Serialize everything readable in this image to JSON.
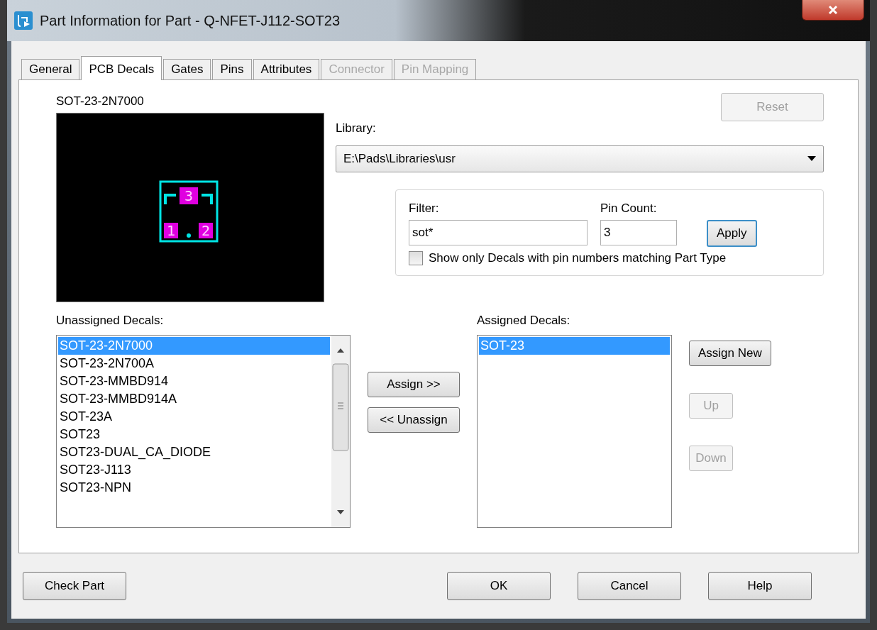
{
  "window": {
    "title": "Part Information for Part - Q-NFET-J112-SOT23"
  },
  "tabs": [
    {
      "label": "General",
      "selected": false,
      "disabled": false
    },
    {
      "label": "PCB Decals",
      "selected": true,
      "disabled": false
    },
    {
      "label": "Gates",
      "selected": false,
      "disabled": false
    },
    {
      "label": "Pins",
      "selected": false,
      "disabled": false
    },
    {
      "label": "Attributes",
      "selected": false,
      "disabled": false
    },
    {
      "label": "Connector",
      "selected": false,
      "disabled": true
    },
    {
      "label": "Pin Mapping",
      "selected": false,
      "disabled": true
    }
  ],
  "preview": {
    "decal_name": "SOT-23-2N7000",
    "pins": [
      "3",
      "1",
      "2"
    ]
  },
  "reset_button": {
    "label": "Reset",
    "disabled": true
  },
  "library": {
    "label": "Library:",
    "value": "E:\\Pads\\Libraries\\usr"
  },
  "filter": {
    "label": "Filter:",
    "value": "sot*"
  },
  "pin_count": {
    "label": "Pin Count:",
    "value": "3"
  },
  "apply_button": {
    "label": "Apply",
    "disabled": false
  },
  "match_checkbox": {
    "label": "Show only Decals with pin numbers matching Part Type",
    "checked": false
  },
  "unassigned": {
    "label": "Unassigned Decals:",
    "items": [
      {
        "label": "SOT-23-2N7000",
        "selected": true
      },
      {
        "label": "SOT-23-2N700A",
        "selected": false
      },
      {
        "label": "SOT-23-MMBD914",
        "selected": false
      },
      {
        "label": "SOT-23-MMBD914A",
        "selected": false
      },
      {
        "label": "SOT-23A",
        "selected": false
      },
      {
        "label": "SOT23",
        "selected": false
      },
      {
        "label": "SOT23-DUAL_CA_DIODE",
        "selected": false
      },
      {
        "label": "SOT23-J113",
        "selected": false
      },
      {
        "label": "SOT23-NPN",
        "selected": false
      }
    ]
  },
  "move_buttons": [
    {
      "label": "Assign >>",
      "disabled": false
    },
    {
      "label": "<< Unassign",
      "disabled": false
    }
  ],
  "assigned": {
    "label": "Assigned Decals:",
    "items": [
      {
        "label": "SOT-23",
        "selected": true
      }
    ]
  },
  "side_buttons": [
    {
      "label": "Assign New",
      "disabled": false
    },
    {
      "label": "Up",
      "disabled": true
    },
    {
      "label": "Down",
      "disabled": true
    }
  ],
  "footer_buttons": [
    {
      "label": "Check Part",
      "disabled": false
    },
    {
      "label": "OK",
      "disabled": false
    },
    {
      "label": "Cancel",
      "disabled": false
    },
    {
      "label": "Help",
      "disabled": false
    }
  ]
}
